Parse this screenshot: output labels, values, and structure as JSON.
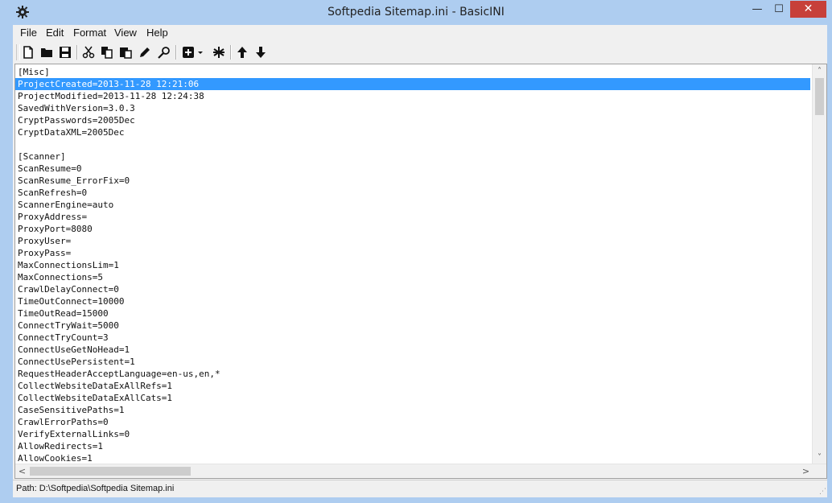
{
  "window": {
    "title": "Softpedia Sitemap.ini - BasicINI",
    "min_glyph": "—",
    "max_glyph": "☐",
    "close_glyph": "✕"
  },
  "menu": [
    "File",
    "Edit",
    "Format",
    "View",
    "Help"
  ],
  "toolbar": {
    "icons": [
      "new-file-icon",
      "open-folder-icon",
      "save-icon",
      "cut-icon",
      "copy-icon",
      "paste-icon",
      "edit-pencil-icon",
      "find-icon",
      "insert-section-icon",
      "dropdown-arrow-icon",
      "asterisk-icon",
      "move-up-icon",
      "move-down-icon"
    ]
  },
  "editor": {
    "lines": [
      "[Misc]",
      "ProjectCreated=2013-11-28 12:21:06",
      "ProjectModified=2013-11-28 12:24:38",
      "SavedWithVersion=3.0.3",
      "CryptPasswords=2005Dec",
      "CryptDataXML=2005Dec",
      "",
      "[Scanner]",
      "ScanResume=0",
      "ScanResume_ErrorFix=0",
      "ScanRefresh=0",
      "ScannerEngine=auto",
      "ProxyAddress=",
      "ProxyPort=8080",
      "ProxyUser=",
      "ProxyPass=",
      "MaxConnectionsLim=1",
      "MaxConnections=5",
      "CrawlDelayConnect=0",
      "TimeOutConnect=10000",
      "TimeOutRead=15000",
      "ConnectTryWait=5000",
      "ConnectTryCount=3",
      "ConnectUseGetNoHead=1",
      "ConnectUsePersistent=1",
      "RequestHeaderAcceptLanguage=en-us,en,*",
      "CollectWebsiteDataExAllRefs=1",
      "CollectWebsiteDataExAllCats=1",
      "CaseSensitivePaths=1",
      "CrawlErrorPaths=0",
      "VerifyExternalLinks=0",
      "AllowRedirects=1",
      "AllowCookies=1"
    ],
    "selected_line_index": 1,
    "selection_color": "#3399ff"
  },
  "scrollbars": {
    "up": "˄",
    "down": "˅",
    "left": "<",
    "right": ">"
  },
  "status": {
    "path": "Path:  D:\\Softpedia\\Softpedia Sitemap.ini"
  },
  "colors": {
    "frame": "#aecdf0",
    "close_button": "#c7403a"
  }
}
